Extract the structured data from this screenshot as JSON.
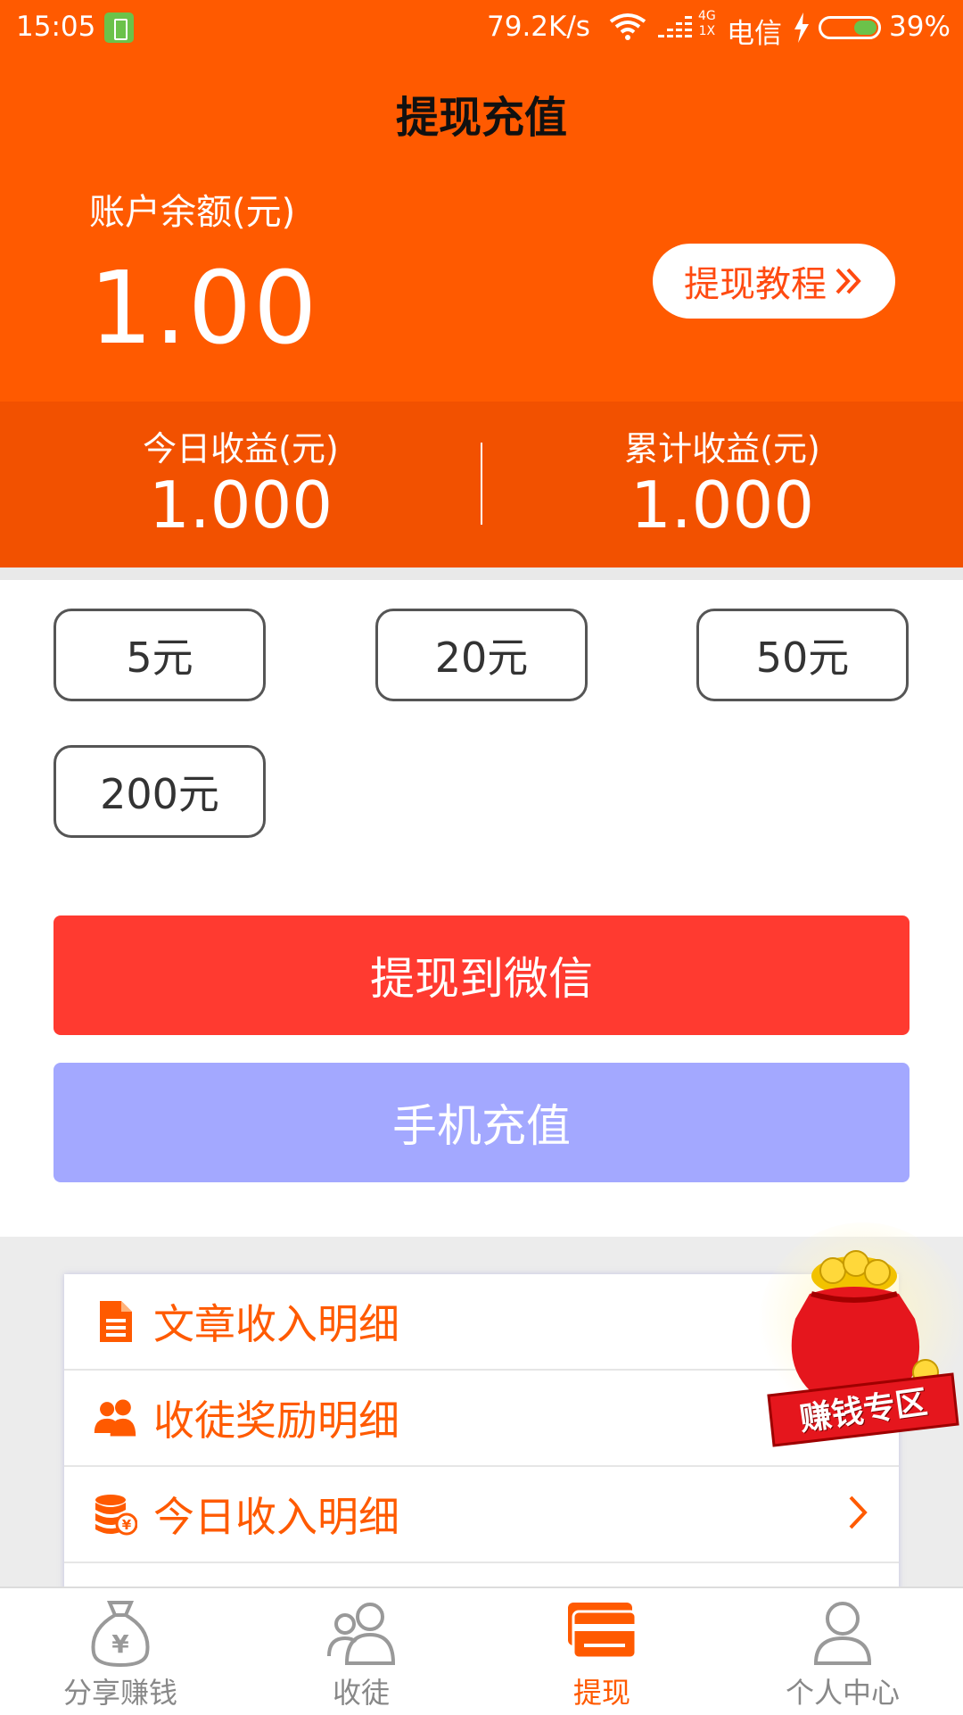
{
  "status_bar": {
    "time": "15:05",
    "network_speed": "79.2K/s",
    "net_type_top": "4G",
    "net_type_bottom": "1X",
    "carrier": "电信",
    "battery": "39%",
    "battery_level": 0.39
  },
  "header": {
    "title": "提现充值",
    "balance_label": "账户余额(元)",
    "balance_value": "1.00",
    "tutorial_label": "提现教程"
  },
  "earnings": {
    "today_label": "今日收益(元)",
    "today_value": "1.000",
    "total_label": "累计收益(元)",
    "total_value": "1.000"
  },
  "amounts": [
    "5元",
    "20元",
    "50元",
    "200元"
  ],
  "actions": {
    "withdraw_wechat": "提现到微信",
    "phone_recharge": "手机充值"
  },
  "details": {
    "items": [
      {
        "label": "文章收入明细",
        "icon": "document-icon"
      },
      {
        "label": "收徒奖励明细",
        "icon": "users-icon"
      },
      {
        "label": "今日收入明细",
        "icon": "coin-stack-icon"
      }
    ]
  },
  "promo": {
    "label": "赚钱专区"
  },
  "bottom_nav": {
    "items": [
      {
        "label": "分享赚钱",
        "icon": "money-bag-icon"
      },
      {
        "label": "收徒",
        "icon": "apprentice-icon"
      },
      {
        "label": "提现",
        "icon": "wallet-card-icon",
        "active": true
      },
      {
        "label": "个人中心",
        "icon": "profile-icon"
      }
    ]
  },
  "colors": {
    "primary": "#ff5a00",
    "earnings_bar": "#f25100",
    "withdraw_button": "#ff3a30",
    "recharge_button": "#a3a8ff"
  }
}
